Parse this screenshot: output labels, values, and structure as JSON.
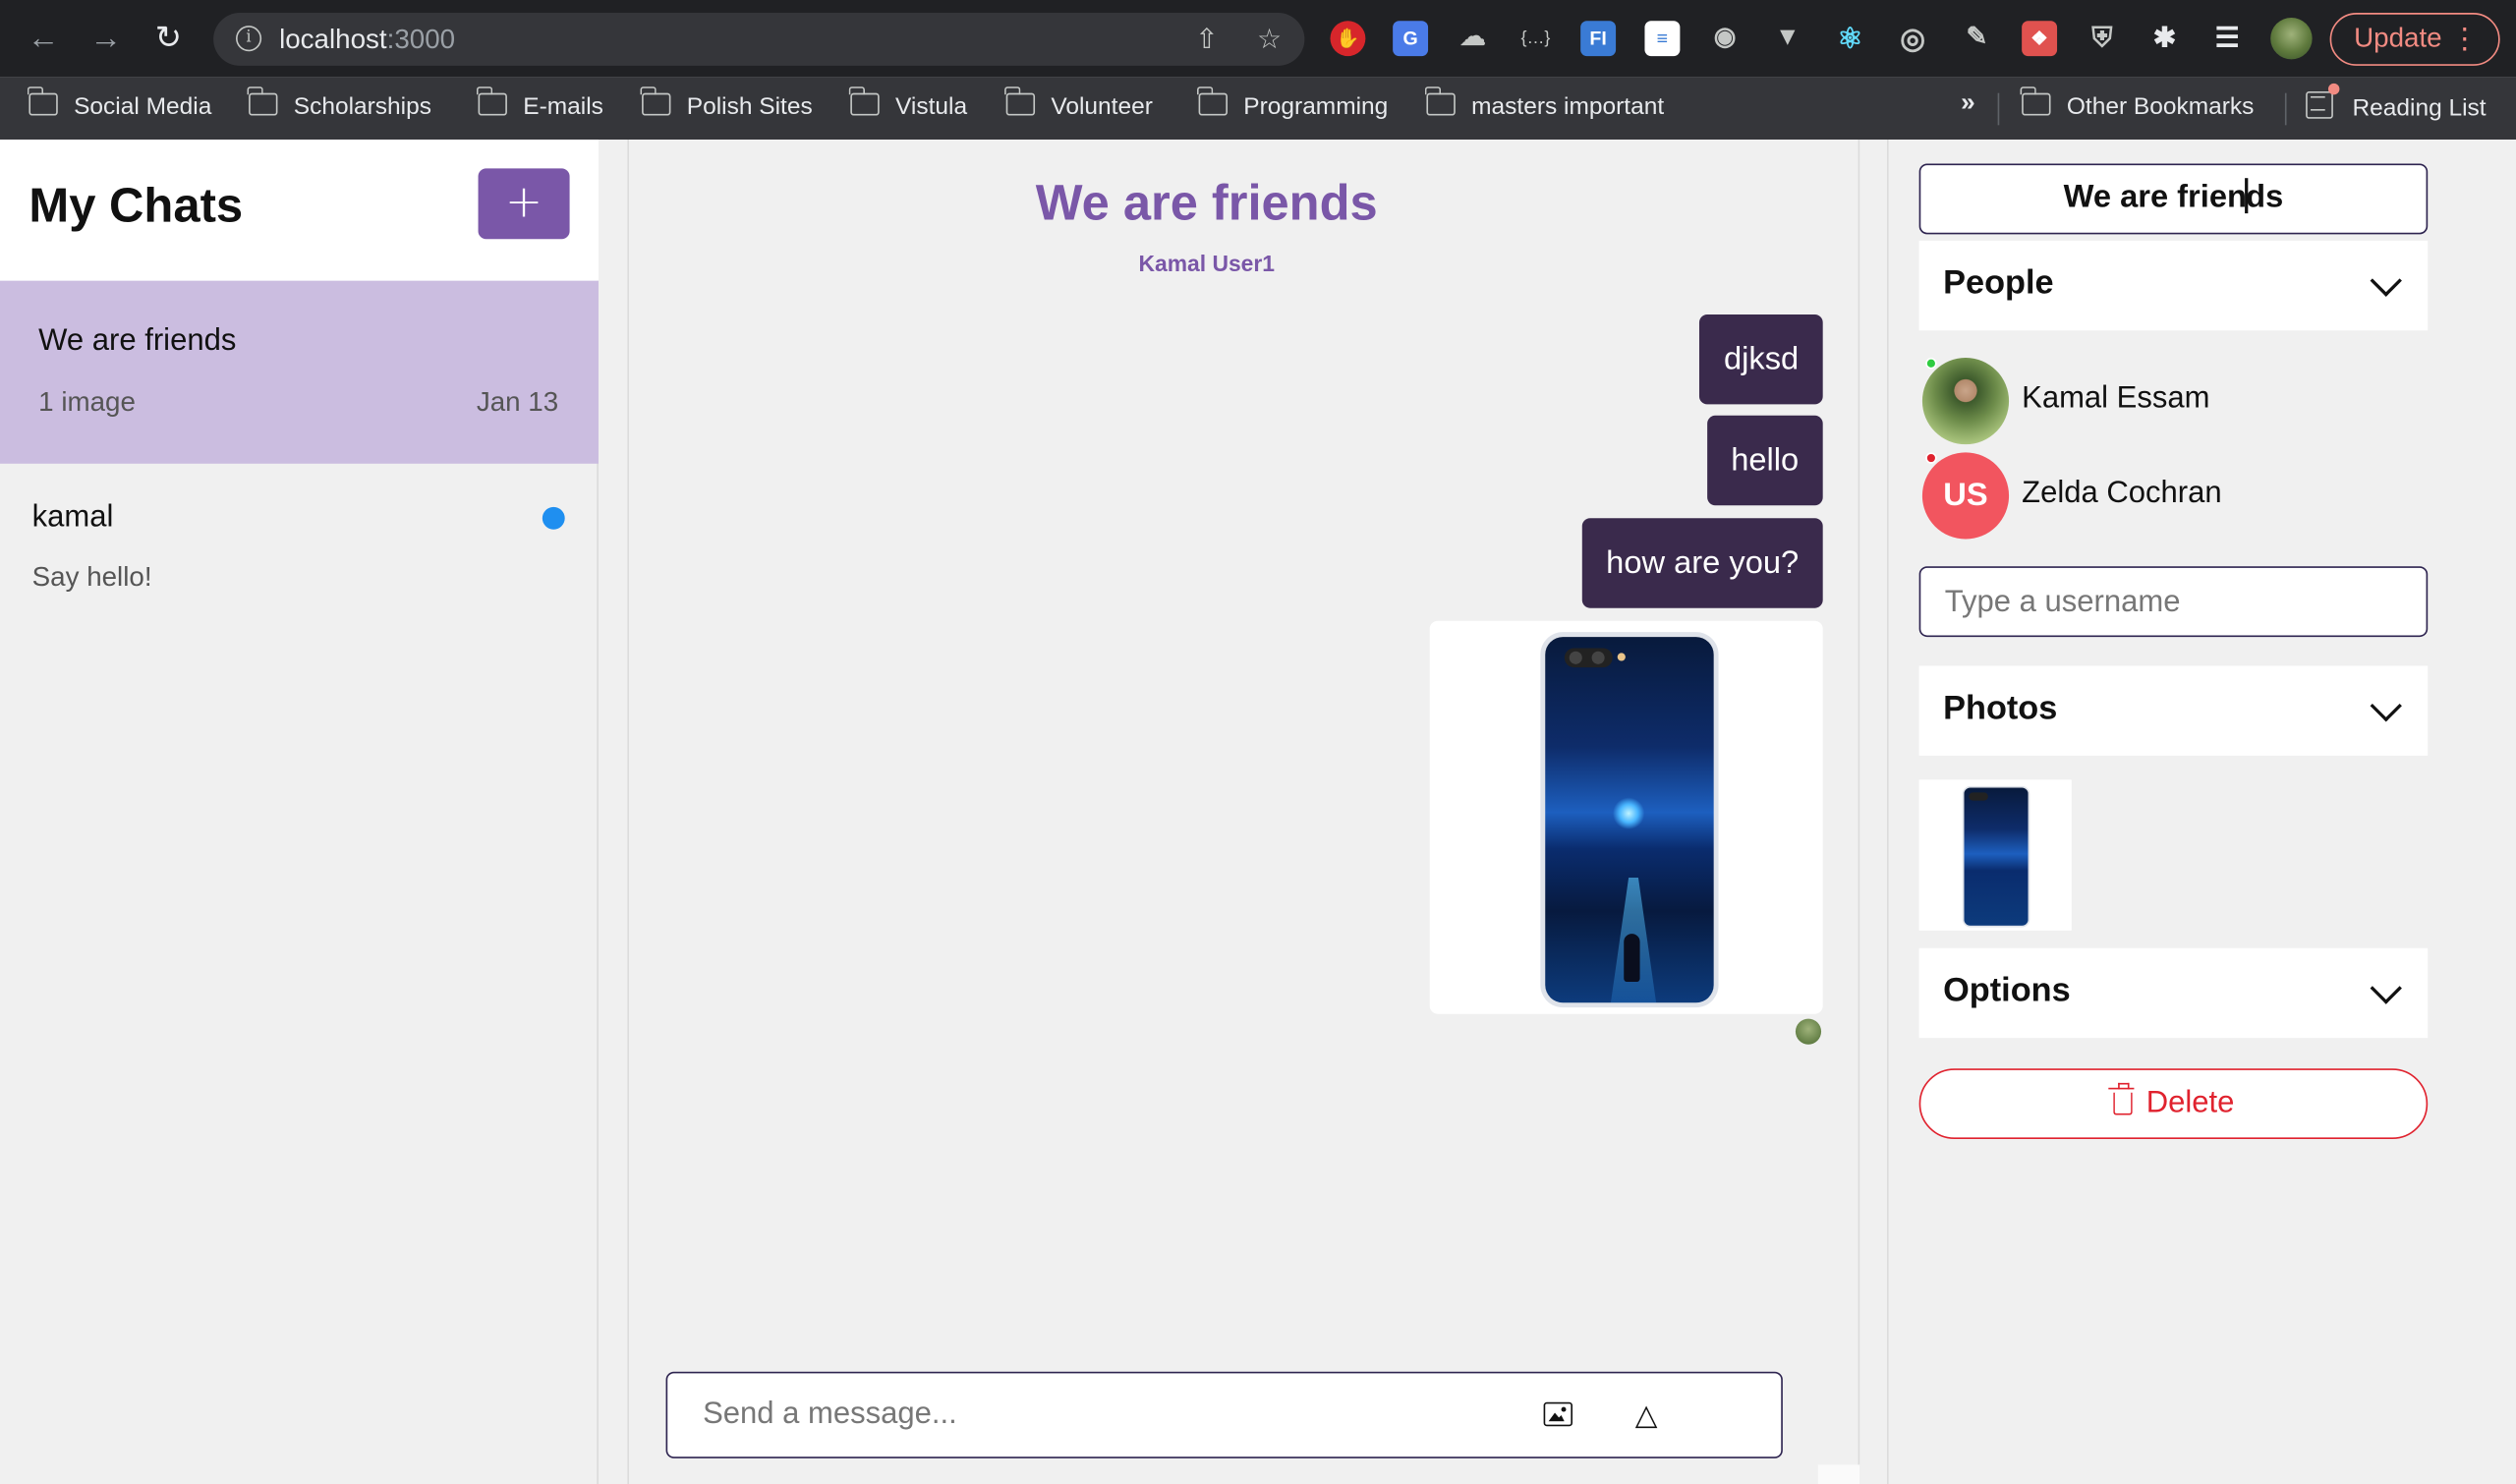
{
  "browser": {
    "url_host": "localhost",
    "url_port": ":3000",
    "update_label": "Update",
    "update_color": "#f28b82",
    "bookmarks": [
      "Social Media",
      "Scholarships",
      "E-mails",
      "Polish Sites",
      "Vistula",
      "Volunteer",
      "Programming",
      "masters important"
    ],
    "overflow_label": "»",
    "other_bookmarks": "Other Bookmarks",
    "reading_list": "Reading List"
  },
  "sidebar": {
    "title": "My Chats",
    "new_chat_label": "+",
    "chats": [
      {
        "title": "We are friends",
        "preview": "1 image",
        "date": "Jan 13",
        "active": true
      },
      {
        "title": "kamal",
        "preview": "Say hello!",
        "unread": true
      }
    ]
  },
  "conversation": {
    "title": "We are friends",
    "participants": "Kamal User1",
    "messages": [
      {
        "text": "djksd"
      },
      {
        "text": "hello"
      },
      {
        "text": "how are you?"
      }
    ],
    "composer_placeholder": "Send a message..."
  },
  "settings": {
    "chat_title_before_caret": "We are frien",
    "chat_title_after_caret": "ds",
    "people_label": "People",
    "people": [
      {
        "name": "Kamal Essam",
        "status_color": "#2ecc40"
      },
      {
        "name": "Zelda Cochran",
        "initials": "US",
        "status_color": "#e0222e"
      }
    ],
    "username_placeholder": "Type a username",
    "photos_label": "Photos",
    "options_label": "Options",
    "delete_label": "Delete"
  },
  "colors": {
    "accent": "#7a57a8",
    "bubble": "#3a2a4c",
    "active_chat": "#cbbde0",
    "danger": "#e0222e",
    "unread": "#1f8ff0"
  }
}
